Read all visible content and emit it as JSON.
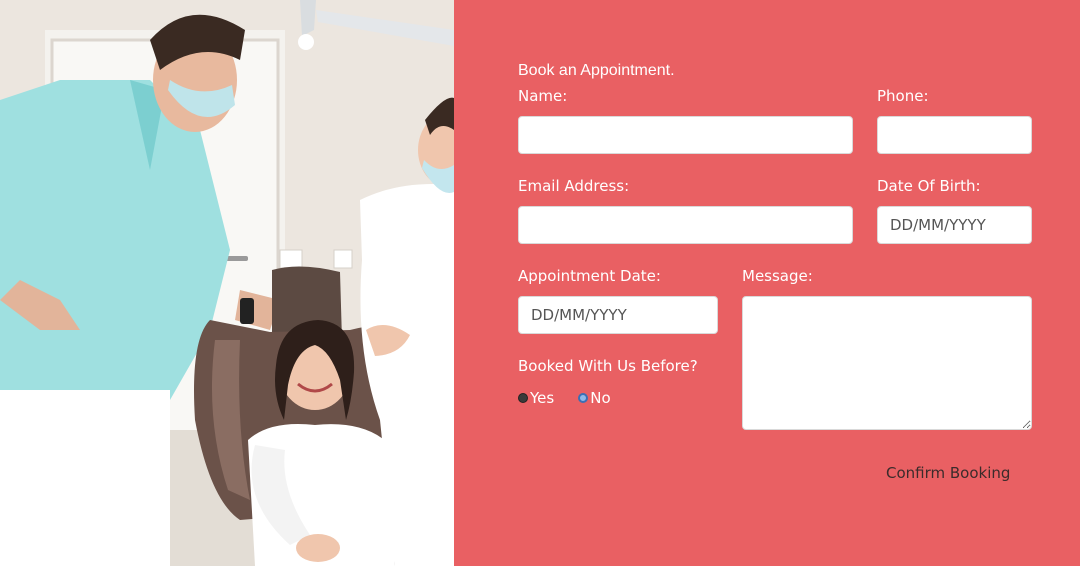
{
  "form": {
    "title": "Book an Appointment.",
    "name_label": "Name:",
    "phone_label": "Phone:",
    "email_label": "Email Address:",
    "dob_label": "Date Of Birth:",
    "dob_placeholder": "DD/MM/YYYY",
    "appt_label": "Appointment Date:",
    "appt_placeholder": "DD/MM/YYYY",
    "message_label": "Message:",
    "booked_label": "Booked With Us Before?",
    "radio_yes": "Yes",
    "radio_no": "No",
    "selected": "No",
    "confirm_label": "Confirm Booking"
  },
  "colors": {
    "panel": "#e96063",
    "field_bg": "#ffffff",
    "button_text": "#3b2b2b"
  },
  "image": {
    "subject": "dentist-with-child-in-chair-photo"
  }
}
